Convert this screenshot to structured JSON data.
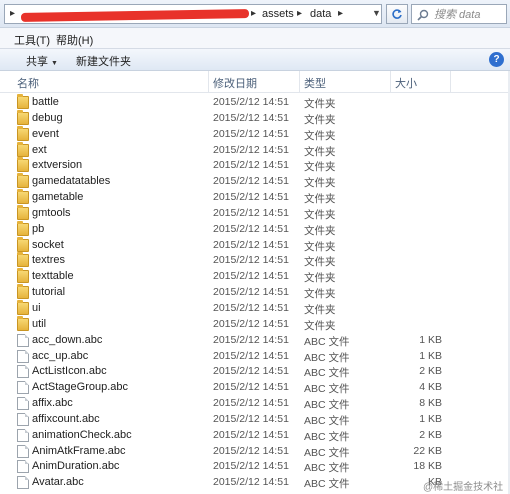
{
  "address": {
    "breadcrumbs": [
      "assets",
      "data"
    ]
  },
  "search": {
    "placeholder": "搜索 data"
  },
  "menu": {
    "tools": "工具(T)",
    "help": "帮助(H)"
  },
  "toolbar": {
    "share": "共享",
    "new_folder": "新建文件夹"
  },
  "columns": {
    "name": "名称",
    "modified": "修改日期",
    "type": "类型",
    "size": "大小"
  },
  "files": [
    {
      "name": "battle",
      "modified": "2015/2/12 14:51",
      "type": "文件夹",
      "size": "",
      "kind": "folder"
    },
    {
      "name": "debug",
      "modified": "2015/2/12 14:51",
      "type": "文件夹",
      "size": "",
      "kind": "folder"
    },
    {
      "name": "event",
      "modified": "2015/2/12 14:51",
      "type": "文件夹",
      "size": "",
      "kind": "folder"
    },
    {
      "name": "ext",
      "modified": "2015/2/12 14:51",
      "type": "文件夹",
      "size": "",
      "kind": "folder"
    },
    {
      "name": "extversion",
      "modified": "2015/2/12 14:51",
      "type": "文件夹",
      "size": "",
      "kind": "folder"
    },
    {
      "name": "gamedatatables",
      "modified": "2015/2/12 14:51",
      "type": "文件夹",
      "size": "",
      "kind": "folder"
    },
    {
      "name": "gametable",
      "modified": "2015/2/12 14:51",
      "type": "文件夹",
      "size": "",
      "kind": "folder"
    },
    {
      "name": "gmtools",
      "modified": "2015/2/12 14:51",
      "type": "文件夹",
      "size": "",
      "kind": "folder"
    },
    {
      "name": "pb",
      "modified": "2015/2/12 14:51",
      "type": "文件夹",
      "size": "",
      "kind": "folder"
    },
    {
      "name": "socket",
      "modified": "2015/2/12 14:51",
      "type": "文件夹",
      "size": "",
      "kind": "folder"
    },
    {
      "name": "textres",
      "modified": "2015/2/12 14:51",
      "type": "文件夹",
      "size": "",
      "kind": "folder"
    },
    {
      "name": "texttable",
      "modified": "2015/2/12 14:51",
      "type": "文件夹",
      "size": "",
      "kind": "folder"
    },
    {
      "name": "tutorial",
      "modified": "2015/2/12 14:51",
      "type": "文件夹",
      "size": "",
      "kind": "folder"
    },
    {
      "name": "ui",
      "modified": "2015/2/12 14:51",
      "type": "文件夹",
      "size": "",
      "kind": "folder"
    },
    {
      "name": "util",
      "modified": "2015/2/12 14:51",
      "type": "文件夹",
      "size": "",
      "kind": "folder"
    },
    {
      "name": "acc_down.abc",
      "modified": "2015/2/12 14:51",
      "type": "ABC 文件",
      "size": "1 KB",
      "kind": "file"
    },
    {
      "name": "acc_up.abc",
      "modified": "2015/2/12 14:51",
      "type": "ABC 文件",
      "size": "1 KB",
      "kind": "file"
    },
    {
      "name": "ActListIcon.abc",
      "modified": "2015/2/12 14:51",
      "type": "ABC 文件",
      "size": "2 KB",
      "kind": "file"
    },
    {
      "name": "ActStageGroup.abc",
      "modified": "2015/2/12 14:51",
      "type": "ABC 文件",
      "size": "4 KB",
      "kind": "file"
    },
    {
      "name": "affix.abc",
      "modified": "2015/2/12 14:51",
      "type": "ABC 文件",
      "size": "8 KB",
      "kind": "file"
    },
    {
      "name": "affixcount.abc",
      "modified": "2015/2/12 14:51",
      "type": "ABC 文件",
      "size": "1 KB",
      "kind": "file"
    },
    {
      "name": "animationCheck.abc",
      "modified": "2015/2/12 14:51",
      "type": "ABC 文件",
      "size": "2 KB",
      "kind": "file"
    },
    {
      "name": "AnimAtkFrame.abc",
      "modified": "2015/2/12 14:51",
      "type": "ABC 文件",
      "size": "22 KB",
      "kind": "file"
    },
    {
      "name": "AnimDuration.abc",
      "modified": "2015/2/12 14:51",
      "type": "ABC 文件",
      "size": "18 KB",
      "kind": "file"
    },
    {
      "name": "Avatar.abc",
      "modified": "2015/2/12 14:51",
      "type": "ABC 文件",
      "size": "KB",
      "kind": "file"
    }
  ],
  "watermark": "@稀土掘金技术社区"
}
